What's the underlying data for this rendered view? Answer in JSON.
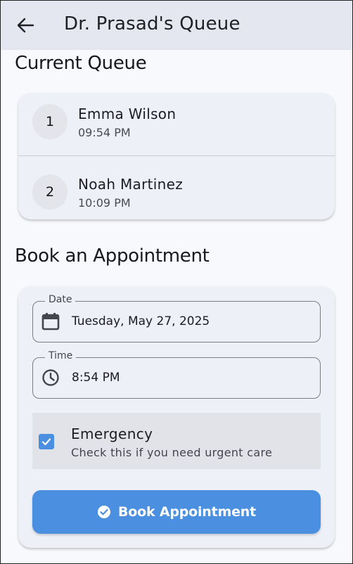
{
  "app_bar": {
    "title": "Dr. Prasad's Queue",
    "back_icon": "arrow-left-icon"
  },
  "queue_section": {
    "title": "Current Queue",
    "patients": [
      {
        "number": "1",
        "name": "Emma Wilson",
        "time": "09:54 PM"
      },
      {
        "number": "2",
        "name": "Noah Martinez",
        "time": "10:09 PM"
      }
    ]
  },
  "booking_section": {
    "title": "Book an Appointment",
    "date_field": {
      "label": "Date",
      "value": "Tuesday, May 27, 2025",
      "icon": "calendar-icon"
    },
    "time_field": {
      "label": "Time",
      "value": "8:54 PM",
      "icon": "clock-icon"
    },
    "emergency": {
      "title": "Emergency",
      "subtitle": "Check this if you need urgent care",
      "checked": true
    },
    "submit_button": {
      "label": "Book Appointment",
      "icon": "check-circle-icon"
    }
  },
  "colors": {
    "accent": "#4a8fe0",
    "app_bar": "#e4e7ef",
    "card": "#eef0f8",
    "background": "#f8f9fc"
  }
}
